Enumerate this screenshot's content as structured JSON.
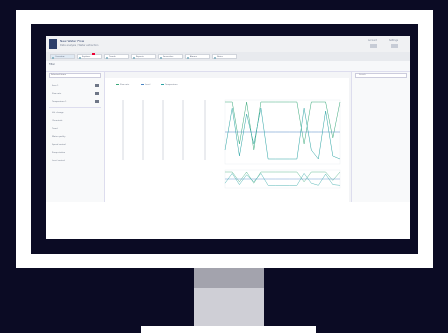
{
  "app": {
    "title": "New Water Flow",
    "subtitle": "Data analysis / Water extraction",
    "header_right": [
      "Account",
      "Settings"
    ]
  },
  "tabs": [
    "Overview",
    "Explorer",
    "Trends",
    "Reports",
    "Favourites",
    "Alarms",
    "Notes"
  ],
  "sub_label": "Filter",
  "left_panel": {
    "select_value": "Selected items",
    "items": [
      "Item 1",
      "Flow rate",
      "Temperature 1",
      "Vol. change",
      "Chemicals",
      "Trend",
      "Water quality",
      "Speed control",
      "Pump station",
      "Level control"
    ]
  },
  "legend": [
    "Flow rate",
    "Level",
    "Temperature"
  ],
  "right_panel": {
    "search_placeholder": "Search"
  },
  "colors": {
    "accent": "#2d3f6a",
    "series_green": "#3aa87a",
    "series_blue": "#4a84c4",
    "series_teal": "#2aa3a3"
  },
  "chart_data": {
    "type": "line",
    "title": "",
    "xlabel": "",
    "ylabel": "",
    "series": [
      {
        "values": [
          1,
          1,
          0.3,
          1,
          0.2,
          1,
          1,
          1,
          1,
          1,
          1,
          0.3,
          1,
          1,
          1,
          0.4,
          1
        ]
      },
      {
        "values": [
          0.5,
          0.5,
          0.5,
          0.5,
          0.5,
          0.5,
          0.5,
          0.5,
          0.5,
          0.5,
          0.5,
          0.5,
          0.5,
          0.5,
          0.5,
          0.5,
          0.5
        ]
      },
      {
        "values": [
          0.2,
          0.9,
          0.1,
          0.8,
          0.3,
          0.9,
          0.05,
          0.05,
          0.05,
          0.05,
          0.05,
          0.9,
          0.2,
          0.05,
          0.85,
          0.1,
          0.05
        ]
      }
    ]
  }
}
